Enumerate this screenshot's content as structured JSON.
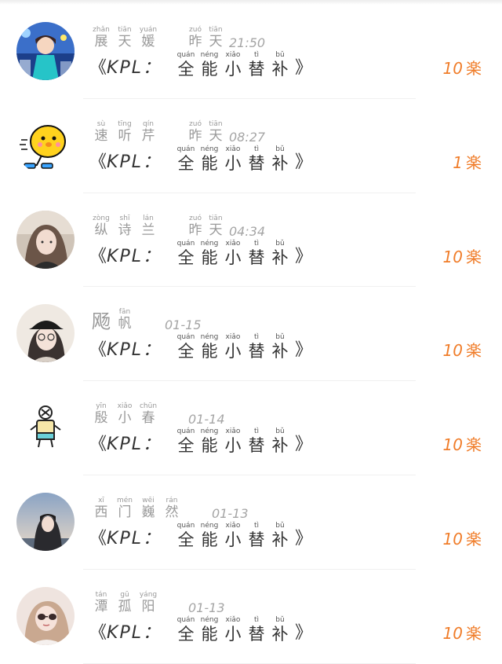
{
  "colors": {
    "count": "#f07d2a",
    "name": "#9a9a9a",
    "title": "#333333",
    "divider": "#f0f0f0"
  },
  "rows": [
    {
      "avatar_icon": "anime-boy-avatar",
      "name": [
        {
          "c": "展",
          "p": "zhǎn"
        },
        {
          "c": "天",
          "p": "tiān"
        },
        {
          "c": "媛",
          "p": "yuán"
        }
      ],
      "time": [
        {
          "c": "昨",
          "p": "zuó"
        },
        {
          "c": "天",
          "p": "tiān"
        },
        {
          "c": "21:50",
          "p": ""
        }
      ],
      "title": {
        "open": "《",
        "brand": "KPL：",
        "chars": [
          {
            "c": "全",
            "p": "quán"
          },
          {
            "c": "能",
            "p": "néng"
          },
          {
            "c": "小",
            "p": "xiǎo"
          },
          {
            "c": "替",
            "p": "tì"
          },
          {
            "c": "补",
            "p": "bǔ"
          }
        ],
        "close": "》"
      },
      "count": "10",
      "unit": "楽"
    },
    {
      "avatar_icon": "yellow-chick-avatar",
      "name": [
        {
          "c": "速",
          "p": "sù"
        },
        {
          "c": "听",
          "p": "tīng"
        },
        {
          "c": "芹",
          "p": "qín"
        }
      ],
      "time": [
        {
          "c": "昨",
          "p": "zuó"
        },
        {
          "c": "天",
          "p": "tiān"
        },
        {
          "c": "08:27",
          "p": ""
        }
      ],
      "title": {
        "open": "《",
        "brand": "KPL：",
        "chars": [
          {
            "c": "全",
            "p": "quán"
          },
          {
            "c": "能",
            "p": "néng"
          },
          {
            "c": "小",
            "p": "xiǎo"
          },
          {
            "c": "替",
            "p": "tì"
          },
          {
            "c": "补",
            "p": "bǔ"
          }
        ],
        "close": "》"
      },
      "count": "1",
      "unit": "楽"
    },
    {
      "avatar_icon": "girl-photo-avatar",
      "name": [
        {
          "c": "纵",
          "p": "zòng"
        },
        {
          "c": "诗",
          "p": "shī"
        },
        {
          "c": "兰",
          "p": "lán"
        }
      ],
      "time": [
        {
          "c": "昨",
          "p": "zuó"
        },
        {
          "c": "天",
          "p": "tiān"
        },
        {
          "c": "04:34",
          "p": ""
        }
      ],
      "title": {
        "open": "《",
        "brand": "KPL：",
        "chars": [
          {
            "c": "全",
            "p": "quán"
          },
          {
            "c": "能",
            "p": "néng"
          },
          {
            "c": "小",
            "p": "xiǎo"
          },
          {
            "c": "替",
            "p": "tì"
          },
          {
            "c": "补",
            "p": "bǔ"
          }
        ],
        "close": "》"
      },
      "count": "10",
      "unit": "楽"
    },
    {
      "avatar_icon": "girl-cap-avatar",
      "name": [
        {
          "c": "飏",
          "p": "",
          "big": true
        },
        {
          "c": "帆",
          "p": "fān"
        }
      ],
      "time": [
        {
          "c": "01-15",
          "p": ""
        }
      ],
      "title": {
        "open": "《",
        "brand": "KPL：",
        "chars": [
          {
            "c": "全",
            "p": "quán"
          },
          {
            "c": "能",
            "p": "néng"
          },
          {
            "c": "小",
            "p": "xiǎo"
          },
          {
            "c": "替",
            "p": "tì"
          },
          {
            "c": "补",
            "p": "bǔ"
          }
        ],
        "close": "》"
      },
      "count": "10",
      "unit": "楽"
    },
    {
      "avatar_icon": "cartoon-figure-avatar",
      "name": [
        {
          "c": "殷",
          "p": "yīn"
        },
        {
          "c": "小",
          "p": "xiǎo"
        },
        {
          "c": "春",
          "p": "chūn"
        }
      ],
      "time": [
        {
          "c": "01-14",
          "p": ""
        }
      ],
      "title": {
        "open": "《",
        "brand": "KPL：",
        "chars": [
          {
            "c": "全",
            "p": "quán"
          },
          {
            "c": "能",
            "p": "néng"
          },
          {
            "c": "小",
            "p": "xiǎo"
          },
          {
            "c": "替",
            "p": "tì"
          },
          {
            "c": "补",
            "p": "bǔ"
          }
        ],
        "close": "》"
      },
      "count": "10",
      "unit": "楽"
    },
    {
      "avatar_icon": "girl-sky-avatar",
      "name": [
        {
          "c": "西",
          "p": "xī"
        },
        {
          "c": "门",
          "p": "mén"
        },
        {
          "c": "巍",
          "p": "wēi"
        },
        {
          "c": "然",
          "p": "rán"
        }
      ],
      "time": [
        {
          "c": "01-13",
          "p": ""
        }
      ],
      "title": {
        "open": "《",
        "brand": "KPL：",
        "chars": [
          {
            "c": "全",
            "p": "quán"
          },
          {
            "c": "能",
            "p": "néng"
          },
          {
            "c": "小",
            "p": "xiǎo"
          },
          {
            "c": "替",
            "p": "tì"
          },
          {
            "c": "补",
            "p": "bǔ"
          }
        ],
        "close": "》"
      },
      "count": "10",
      "unit": "楽"
    },
    {
      "avatar_icon": "girl-sunglasses-avatar",
      "name": [
        {
          "c": "潭",
          "p": "tán"
        },
        {
          "c": "孤",
          "p": "gū"
        },
        {
          "c": "阳",
          "p": "yáng"
        }
      ],
      "time": [
        {
          "c": "01-13",
          "p": ""
        }
      ],
      "title": {
        "open": "《",
        "brand": "KPL：",
        "chars": [
          {
            "c": "全",
            "p": "quán"
          },
          {
            "c": "能",
            "p": "néng"
          },
          {
            "c": "小",
            "p": "xiǎo"
          },
          {
            "c": "替",
            "p": "tì"
          },
          {
            "c": "补",
            "p": "bǔ"
          }
        ],
        "close": "》"
      },
      "count": "10",
      "unit": "楽"
    }
  ]
}
